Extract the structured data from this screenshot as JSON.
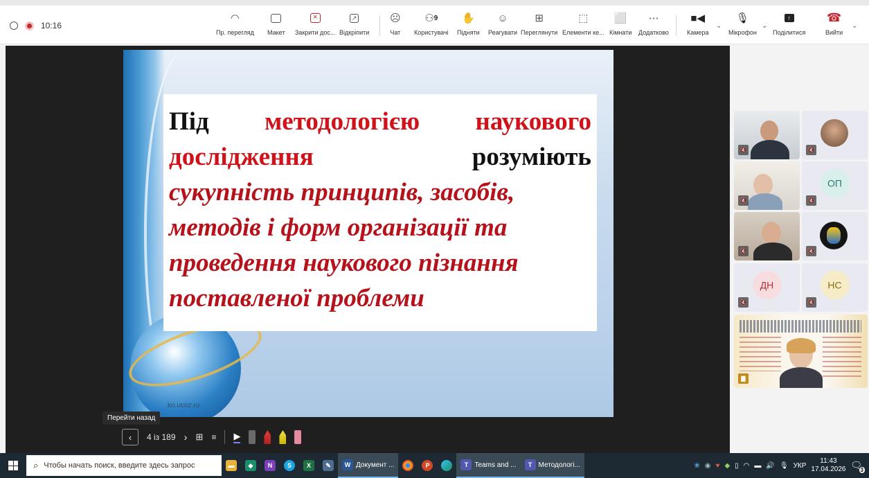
{
  "status": {
    "time": "10:16"
  },
  "toolbar": {
    "items": [
      {
        "label": "Пр. перегляд",
        "icon": "preview-icon"
      },
      {
        "label": "Макет",
        "icon": "layout-icon"
      },
      {
        "label": "Закрити дос...",
        "icon": "stop-share-icon"
      },
      {
        "label": "Відкріпити",
        "icon": "unpin-icon"
      },
      {
        "label": "Чат",
        "icon": "chat-icon"
      },
      {
        "label": "Користувачі",
        "icon": "people-icon",
        "count": "9"
      },
      {
        "label": "Підняти",
        "icon": "raise-hand-icon"
      },
      {
        "label": "Реагувати",
        "icon": "react-icon"
      },
      {
        "label": "Переглянути",
        "icon": "view-icon"
      },
      {
        "label": "Елементи ке...",
        "icon": "apps-icon"
      },
      {
        "label": "Кімнати",
        "icon": "rooms-icon"
      },
      {
        "label": "Додатково",
        "icon": "more-icon"
      },
      {
        "label": "Камера",
        "icon": "camera-icon"
      },
      {
        "label": "Мікрофон",
        "icon": "mic-icon"
      },
      {
        "label": "Поділитися",
        "icon": "share-icon"
      },
      {
        "label": "Вийти",
        "icon": "leave-icon"
      }
    ],
    "colors": {
      "leave": "#c4262e",
      "record": "#c4262e"
    }
  },
  "slide": {
    "line1": [
      "Під",
      "методологією",
      "наукового"
    ],
    "line2": [
      "дослідження",
      "розуміють"
    ],
    "line3": "сукупність принципів, засобів,",
    "line4": "методів і форм організації та",
    "line5": "проведення наукового пізнання",
    "line6": "поставленої проблеми",
    "url": "ko.ucoz.ru"
  },
  "controls": {
    "tooltip": "Перейти назад",
    "page": "4 із 189"
  },
  "participants": [
    {
      "initials": "",
      "video": true
    },
    {
      "initials": "",
      "video": true
    },
    {
      "initials": "",
      "video": true
    },
    {
      "initials": "ОП",
      "video": false,
      "color": "#2b7a6f"
    },
    {
      "initials": "",
      "video": true
    },
    {
      "initials": "",
      "video": true
    },
    {
      "initials": "ДН",
      "video": false,
      "color": "#b0323a"
    },
    {
      "initials": "НС",
      "video": false,
      "color": "#8a6d12"
    }
  ],
  "taskbar": {
    "search_placeholder": "Чтобы начать поиск, введите здесь запрос",
    "apps": [
      "Документ ...",
      "Teams and ...",
      "Методологі..."
    ],
    "lang": "УКР",
    "time": "11:43",
    "date": "17.04.2026",
    "notifications": "3"
  }
}
